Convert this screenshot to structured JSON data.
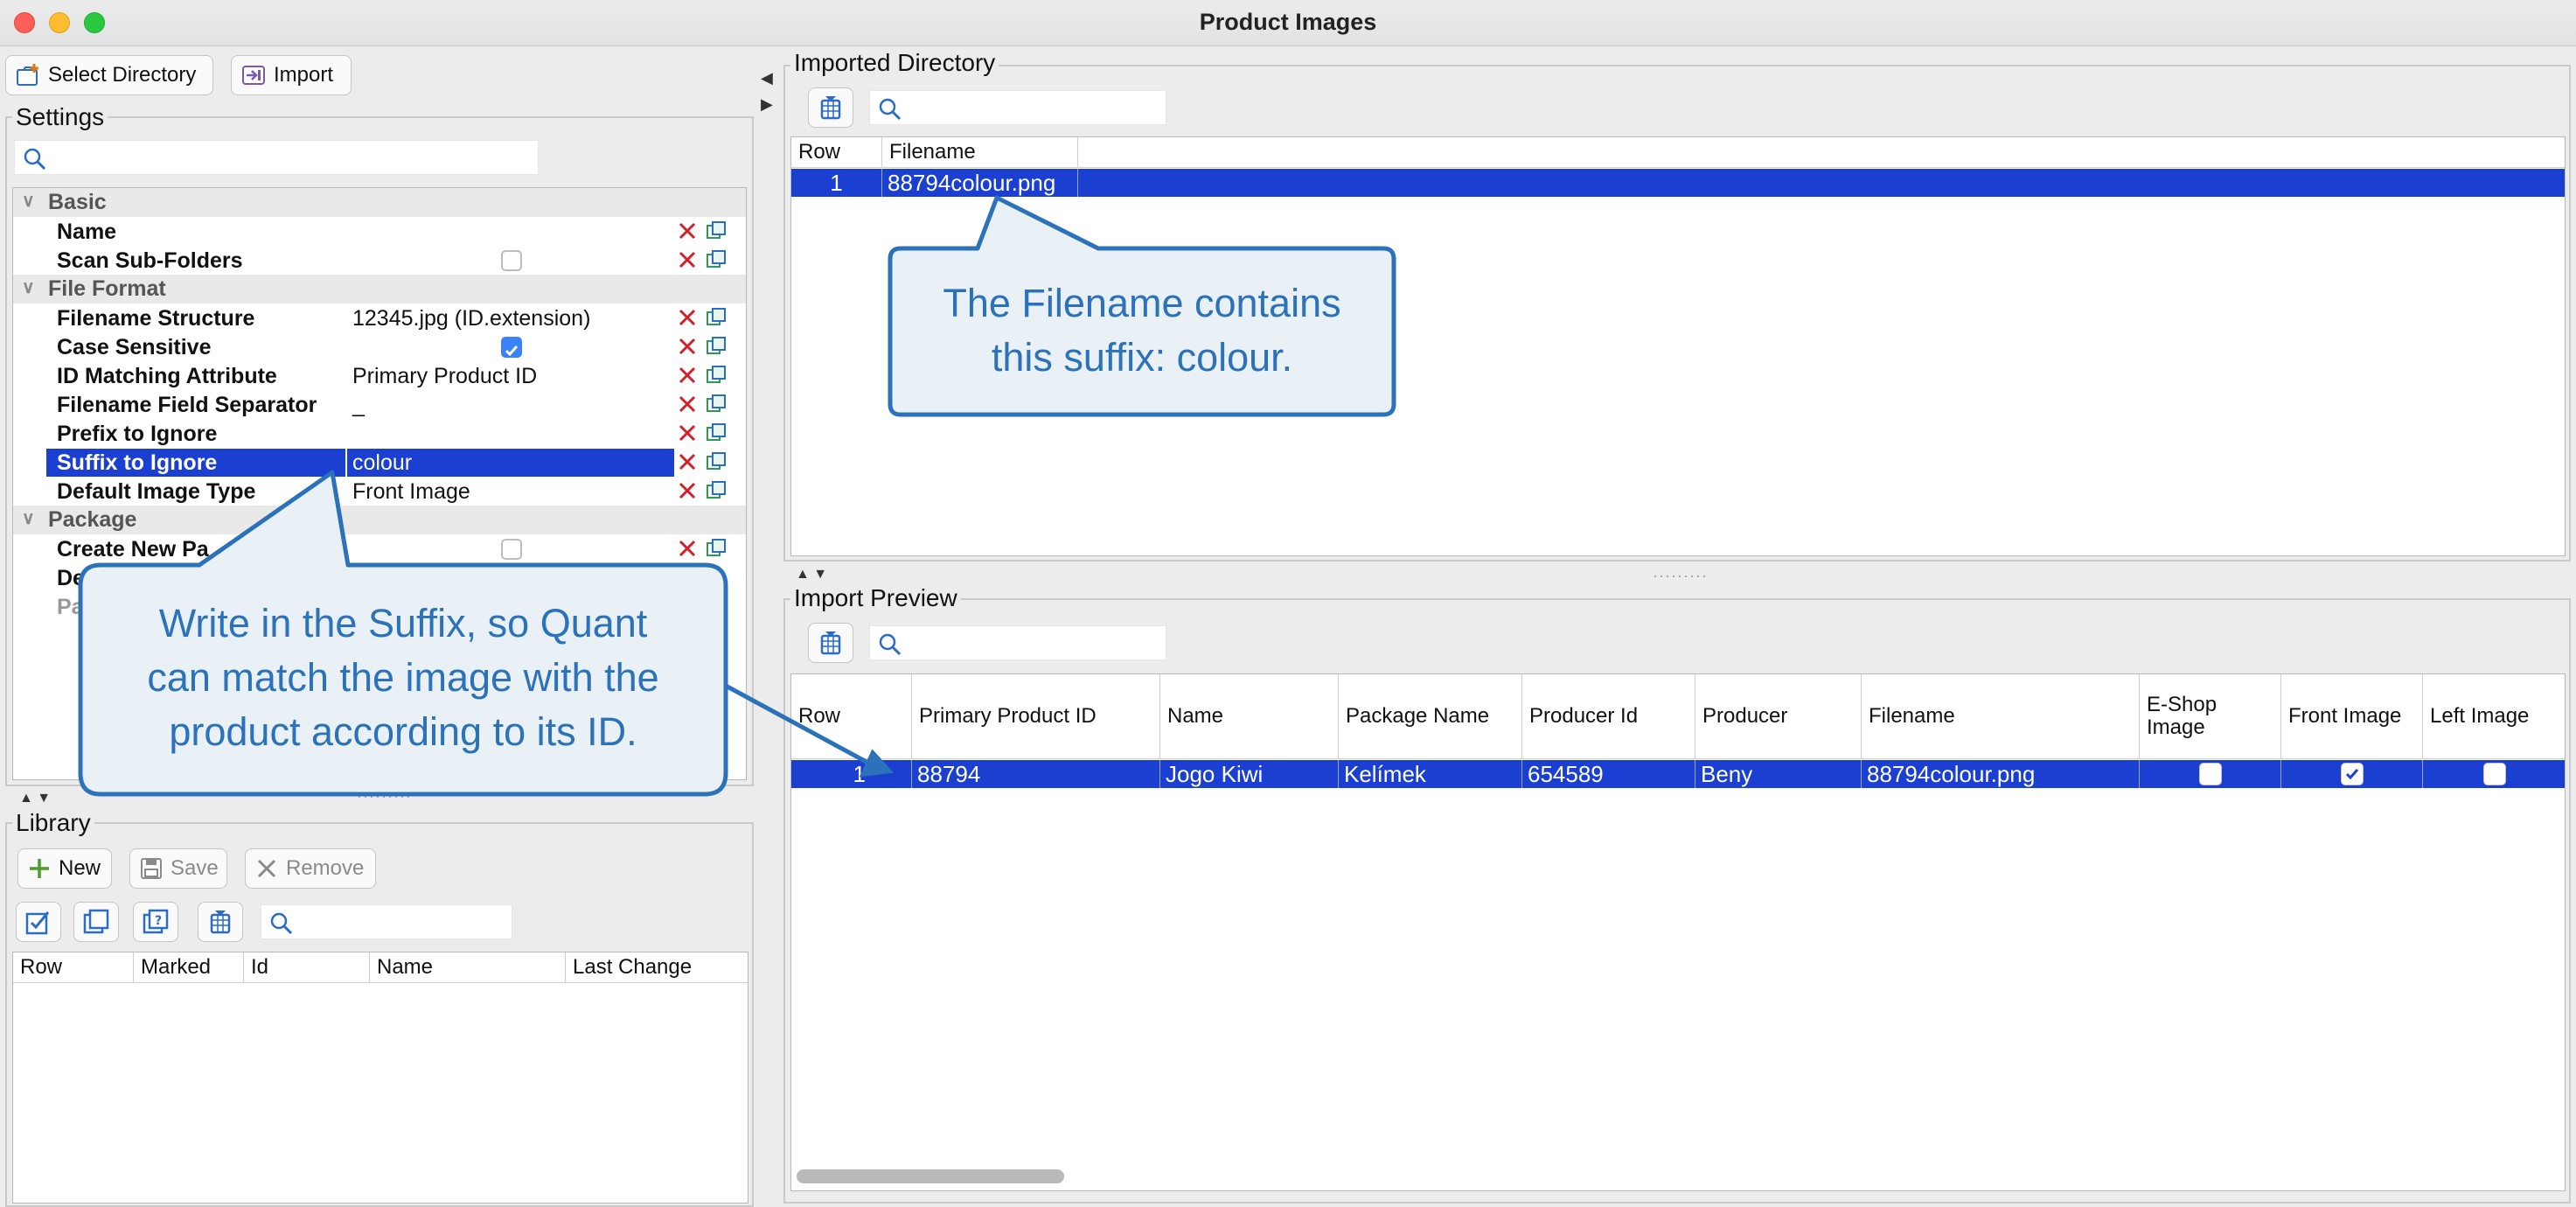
{
  "window": {
    "title": "Product Images"
  },
  "toolbar": {
    "select_directory": "Select Directory",
    "import": "Import"
  },
  "settings": {
    "label": "Settings",
    "search_placeholder": "",
    "categories": [
      "Basic",
      "File Format",
      "Package"
    ],
    "rows": {
      "name": {
        "label": "Name",
        "value": ""
      },
      "scan_sub_folders": {
        "label": "Scan Sub-Folders",
        "checked": false
      },
      "filename_structure": {
        "label": "Filename Structure",
        "value": "12345.jpg (ID.extension)"
      },
      "case_sensitive": {
        "label": "Case Sensitive",
        "checked": true
      },
      "id_matching_attribute": {
        "label": "ID Matching Attribute",
        "value": "Primary Product ID"
      },
      "filename_field_separator": {
        "label": "Filename Field Separator",
        "value": "_"
      },
      "prefix_to_ignore": {
        "label": "Prefix to Ignore",
        "value": ""
      },
      "suffix_to_ignore": {
        "label": "Suffix to Ignore",
        "value": "colour"
      },
      "default_image_type": {
        "label": "Default Image Type",
        "value": "Front Image"
      },
      "create_new_package": {
        "label": "Create New Pa",
        "checked": false
      },
      "default_package": {
        "label": "Def"
      },
      "package_other": {
        "label": "Pac"
      }
    }
  },
  "library": {
    "label": "Library",
    "new": "New",
    "save": "Save",
    "remove": "Remove",
    "columns": [
      "Row",
      "Marked",
      "Id",
      "Name",
      "Last Change"
    ]
  },
  "imported_directory": {
    "label": "Imported Directory",
    "columns": [
      "Row",
      "Filename"
    ],
    "rows": [
      {
        "row": "1",
        "filename": "88794colour.png"
      }
    ]
  },
  "import_preview": {
    "label": "Import Preview",
    "columns": [
      "Row",
      "Primary Product ID",
      "Name",
      "Package Name",
      "Producer Id",
      "Producer",
      "Filename",
      "E-Shop Image",
      "Front Image",
      "Left Image"
    ],
    "rows": [
      {
        "row": "1",
        "primary_product_id": "88794",
        "name": "Jogo Kiwi",
        "package_name": "Kelímek",
        "producer_id": "654589",
        "producer": "Beny",
        "filename": "88794colour.png",
        "eshop_image": false,
        "front_image": true,
        "left_image": false
      }
    ]
  },
  "callouts": {
    "filename_line1": "The Filename contains",
    "filename_line2": "this suffix: colour.",
    "suffix_line1": "Write in the Suffix, so Quant",
    "suffix_line2": "can match the image with the",
    "suffix_line3": "product according to its ID."
  },
  "colors": {
    "selection": "#1a3fd1",
    "callout_border": "#2b72ba",
    "callout_fill": "#e9f0f6",
    "callout_text": "#2b72ba"
  }
}
